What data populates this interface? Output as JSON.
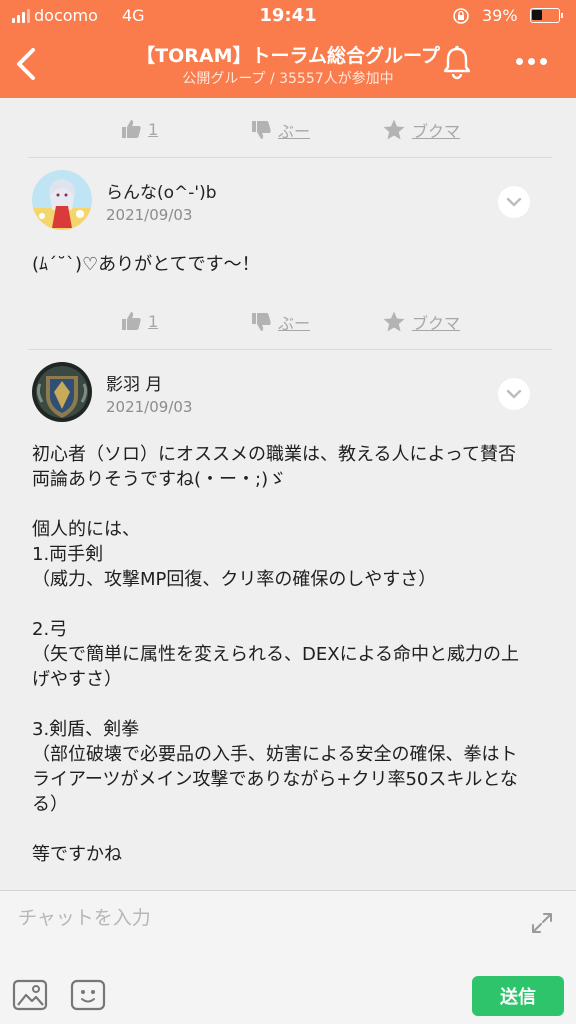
{
  "status_bar": {
    "carrier": "docomo",
    "network": "4G",
    "time": "19:41",
    "battery": "39%",
    "battery_level": 0.39
  },
  "header": {
    "title": "【TORAM】トーラム総合グループ",
    "subtitle": "公開グループ / 35557人が参加中",
    "accent": "#fa7b4c"
  },
  "posts": [
    {
      "actions": {
        "like_count": "1",
        "boo_label": "ぶー",
        "bookmark_label": "ブクマ"
      }
    },
    {
      "user_name": "らんな(o^-')b",
      "date": "2021/09/03",
      "body": "(ﾑ´˘`)♡ありがとてです〜！",
      "actions": {
        "like_count": "1",
        "boo_label": "ぶー",
        "bookmark_label": "ブクマ"
      }
    },
    {
      "user_name": "影羽 月",
      "date": "2021/09/03",
      "body": "初心者（ソロ）にオススメの職業は、教える人によって賛否両論ありそうですね(・ー・;)ゞ\n\n個人的には、\n1.両手剣\n（威力、攻撃MP回復、クリ率の確保のしやすさ）\n\n2.弓\n（矢で簡単に属性を変えられる、DEXによる命中と威力の上げやすさ）\n\n3.剣盾、剣拳\n（部位破壊で必要品の入手、妨害による安全の確保、拳はトライアーツがメイン攻撃でありながら+クリ率50スキルとなる）\n\n等ですかね"
    }
  ],
  "composer": {
    "placeholder": "チャットを入力",
    "send_label": "送信",
    "send_color": "#2dc46b"
  }
}
